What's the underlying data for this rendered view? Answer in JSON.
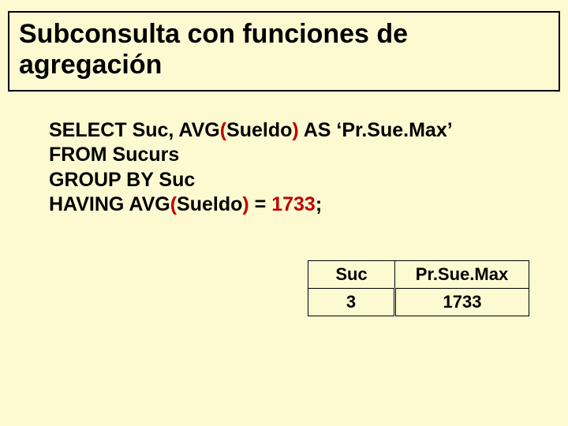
{
  "title": "Subconsulta con funciones de agregación",
  "sql": {
    "line1_a": "SELECT Suc, AVG",
    "line1_p1": "(",
    "line1_b": "Sueldo",
    "line1_p2": ")",
    "line1_c": " AS ‘Pr.Sue.Max’",
    "line2": "FROM Sucurs",
    "line3": "GROUP BY Suc",
    "line4_a": "HAVING AVG",
    "line4_p1": "(",
    "line4_b": "Sueldo",
    "line4_p2": ")",
    "line4_c": " = ",
    "line4_num": "1733",
    "line4_d": ";"
  },
  "table": {
    "headers": {
      "suc": "Suc",
      "pr": "Pr.Sue.Max"
    },
    "row": {
      "suc": "3",
      "pr": "1733"
    }
  }
}
